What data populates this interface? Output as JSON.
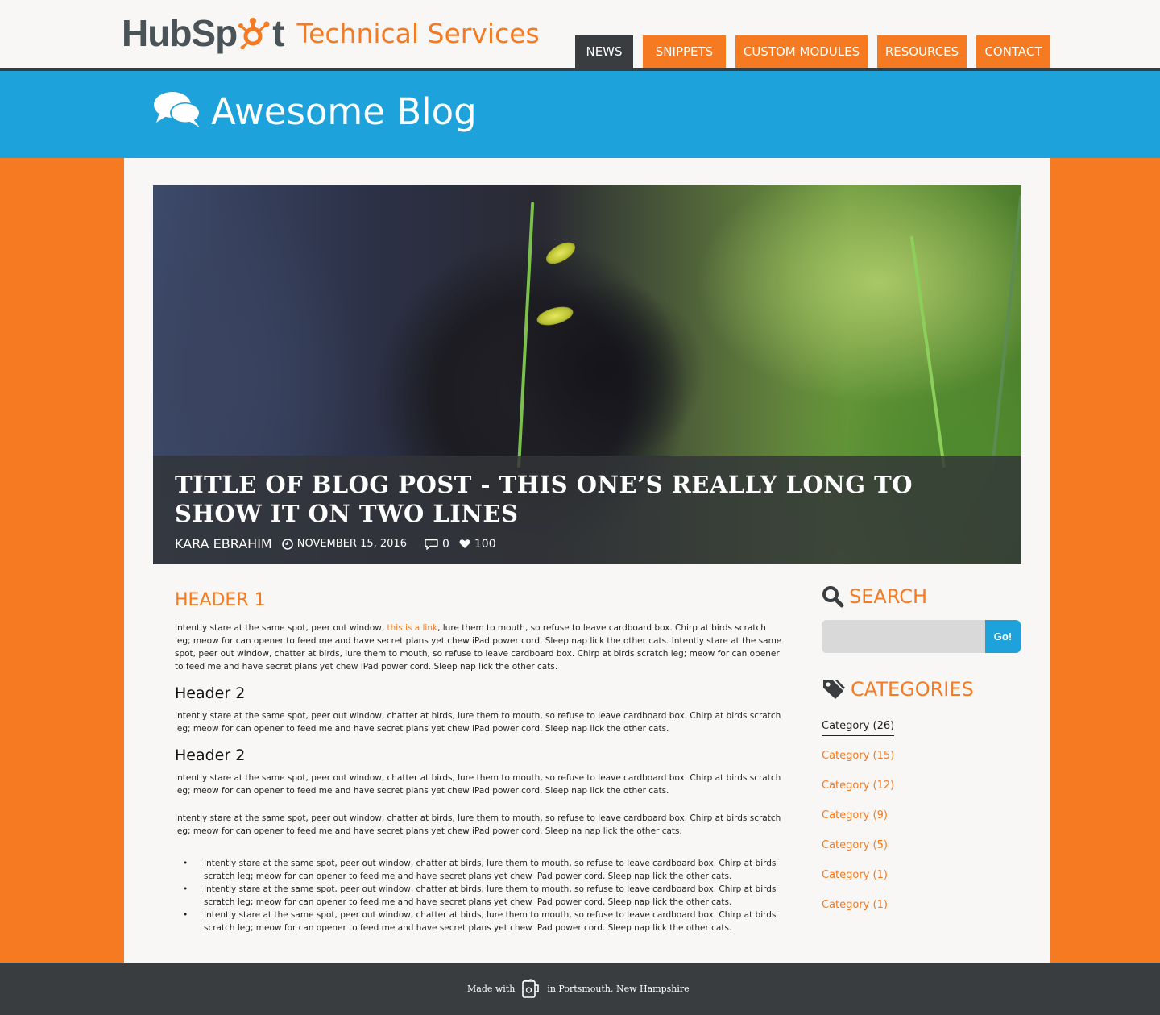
{
  "brand": {
    "name_part1": "HubSp",
    "name_part2": "t",
    "subtitle": "Technical Services",
    "accent_color": "#f67a21",
    "dark_color": "#3a3d40",
    "blue_color": "#1ea2dc"
  },
  "nav": {
    "items": [
      {
        "label": "NEWS",
        "active": true
      },
      {
        "label": "SNIPPETS",
        "active": false
      },
      {
        "label": "CUSTOM MODULES",
        "active": false
      },
      {
        "label": "RESOURCES",
        "active": false
      },
      {
        "label": "CONTACT",
        "active": false
      }
    ]
  },
  "banner": {
    "icon": "chat-bubbles-icon",
    "title": "Awesome Blog"
  },
  "post": {
    "title": "Title of Blog Post - This One’s Really Long to Show it on Two Lines",
    "author": "KARA EBRAHIM",
    "date": "NOVEMBER 15, 2016",
    "comments": "0",
    "likes": "100"
  },
  "article": {
    "header1": "HEADER 1",
    "p1_before": "Intently stare at the same spot, peer out window, ",
    "p1_link": "this is a link",
    "p1_after": ", lure them to mouth, so refuse to leave cardboard box. Chirp at birds scratch leg; meow for can opener to feed me and have secret plans yet chew iPad power cord. Sleep nap lick the other cats. Intently stare at the same spot, peer out window, chatter at birds, lure them to mouth, so refuse to leave cardboard box. Chirp at birds scratch leg; meow for can opener to feed me and have secret plans yet chew iPad power cord. Sleep nap lick the other cats.",
    "header2a": "Header 2",
    "p2": "Intently stare at the same spot, peer out window, chatter at birds, lure them to mouth, so refuse to leave cardboard box. Chirp at birds scratch leg; meow for can opener to feed me and have secret plans yet chew iPad power cord. Sleep nap lick the other cats.",
    "header2b": "Header 2",
    "p3": "Intently stare at the same spot, peer out window, chatter at birds, lure them to mouth, so refuse to leave cardboard box. Chirp at birds scratch leg; meow for can opener to feed me and have secret plans yet chew iPad power cord. Sleep nap lick the other cats.",
    "p4": "Intently stare at the same spot, peer out window, chatter at birds, lure them to mouth, so refuse to leave cardboard box. Chirp at birds scratch leg; meow for can opener to feed me and have secret plans yet chew iPad power cord. Sleep na nap lick the other cats.",
    "list": [
      "Intently stare at the same spot, peer out window, chatter at birds, lure them to mouth, so refuse to leave cardboard box. Chirp at birds scratch leg; meow for can opener to feed me and have secret plans yet chew iPad power cord. Sleep nap lick the other cats.",
      "Intently stare at the same spot, peer out window, chatter at birds, lure them to mouth, so refuse to leave cardboard box. Chirp at birds scratch leg; meow for can opener to feed me and have secret plans yet chew iPad power cord. Sleep nap lick the other cats.",
      "Intently stare at the same spot, peer out window, chatter at birds, lure them to mouth, so refuse to leave cardboard box. Chirp at birds scratch leg; meow for can opener to feed me and have secret plans yet chew iPad power cord. Sleep nap lick the other cats."
    ]
  },
  "sidebar": {
    "search_heading": "SEARCH",
    "search_placeholder": "",
    "search_button": "Go!",
    "categories_heading": "CATEGORIES",
    "categories": [
      "Category (26)",
      "Category (15)",
      "Category (12)",
      "Category (9)",
      "Category (5)",
      "Category (1)",
      "Category (1)"
    ]
  },
  "footer": {
    "made_with": "Made with",
    "location": "in Portsmouth, New Hampshire"
  }
}
